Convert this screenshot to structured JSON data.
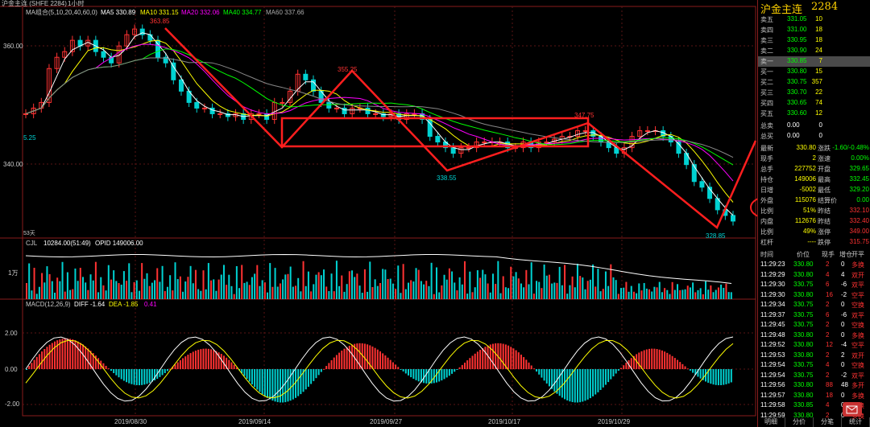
{
  "header": {
    "instrument": "沪金主连 (SHFE 2284)",
    "period": "1小时",
    "ma_title": "MA组合(5,10,20,40,60,0)",
    "ma": [
      {
        "label": "MA5 330.89",
        "color": "#ffffff"
      },
      {
        "label": "MA10 331.15",
        "color": "#ffff00"
      },
      {
        "label": "MA20 332.06",
        "color": "#ff00ff"
      },
      {
        "label": "MA40 334.77",
        "color": "#00ff00"
      },
      {
        "label": "MA60 337.66",
        "color": "#888888"
      }
    ]
  },
  "colors": {
    "up": "#ff3232",
    "down": "#00d2d2",
    "annotation": "#ff1e1e",
    "grid": "#5a1414"
  },
  "price_axis": [
    "360.00",
    "340.00",
    "5.25",
    "53天"
  ],
  "price_labels": {
    "high": "363.85",
    "peak2": "355.25",
    "left": "5.25",
    "low1": "338.55",
    "peak3": "347.75",
    "low2": "328.85",
    "below": "328.8"
  },
  "volume_panel": {
    "title": "CJL",
    "value": "10284.00(51:49)",
    "opid": "OPID 149006.00",
    "axis": "1万"
  },
  "macd_panel": {
    "title": "MACD(12,26,9)",
    "diff": "DIFF -1.64",
    "dea": "DEA -1.85",
    "macd": "0.41",
    "axis": [
      "2.00",
      "0.00",
      "-2.00"
    ]
  },
  "x_axis": [
    "2019/08/30",
    "2019/09/14",
    "2019/09/27",
    "2019/10/17",
    "2019/10/29"
  ],
  "chart_data": {
    "type": "candlestick",
    "title": "沪金主连 (SHFE 2284) 1小时",
    "ylim": [
      326,
      367
    ],
    "annotated_points": [
      {
        "label": "363.85",
        "x": "2019/09/04",
        "y": 363.85
      },
      {
        "label": "355.25",
        "x": "2019/09/24",
        "y": 355.25
      },
      {
        "label": "338.55",
        "x": "2019/10/01",
        "y": 338.55
      },
      {
        "label": "347.75",
        "x": "2019/10/23",
        "y": 347.75
      },
      {
        "label": "328.85",
        "x": "2019/11/08",
        "y": 328.85
      }
    ],
    "close_series": [
      348,
      349,
      350,
      356,
      358,
      359,
      361,
      360,
      361,
      359,
      358,
      357,
      360,
      362,
      363,
      362,
      361,
      358,
      357,
      354,
      352,
      350,
      349,
      349,
      348,
      348,
      347.5,
      348,
      347,
      348,
      348,
      347,
      350,
      350,
      352,
      355,
      354,
      352,
      350,
      349,
      349,
      348,
      349,
      349,
      348,
      348,
      347.5,
      348,
      347,
      348,
      348,
      347,
      344,
      343,
      342,
      341,
      342,
      342,
      343,
      343,
      343,
      343,
      342,
      342,
      343,
      342,
      343,
      343,
      343.5,
      344,
      344,
      345,
      345,
      344,
      343,
      342,
      341,
      342,
      344,
      345,
      345,
      345,
      344,
      343,
      341,
      339,
      336,
      335,
      333,
      331,
      330,
      329
    ]
  },
  "quote": {
    "title": "沪金主连",
    "code": "2284",
    "book": [
      {
        "label": "卖五",
        "price": "331.05",
        "vol": "10"
      },
      {
        "label": "卖四",
        "price": "331.00",
        "vol": "18"
      },
      {
        "label": "卖三",
        "price": "330.95",
        "vol": "18"
      },
      {
        "label": "卖二",
        "price": "330.90",
        "vol": "24"
      },
      {
        "label": "卖一",
        "price": "330.85",
        "vol": "7"
      },
      {
        "label": "买一",
        "price": "330.80",
        "vol": "15"
      },
      {
        "label": "买二",
        "price": "330.75",
        "vol": "357"
      },
      {
        "label": "买三",
        "price": "330.70",
        "vol": "22"
      },
      {
        "label": "买四",
        "price": "330.65",
        "vol": "74"
      },
      {
        "label": "买五",
        "price": "330.60",
        "vol": "12"
      }
    ],
    "totals": [
      {
        "label": "总卖",
        "price": "0.00",
        "vol": "0"
      },
      {
        "label": "总买",
        "price": "0.00",
        "vol": "0"
      }
    ],
    "stats": [
      {
        "l1": "最新",
        "v1": "330.80",
        "l2": "涨跌",
        "v2": "-1.60/-0.48%"
      },
      {
        "l1": "现手",
        "v1": "2",
        "l2": "涨速",
        "v2": "0.00%"
      },
      {
        "l1": "总手",
        "v1": "227752",
        "l2": "开盘",
        "v2": "329.65"
      },
      {
        "l1": "持仓",
        "v1": "149006",
        "l2": "最高",
        "v2": "332.45"
      },
      {
        "l1": "日增",
        "v1": "-5002",
        "l2": "最低",
        "v2": "329.20"
      },
      {
        "l1": "外盘",
        "v1": "115076",
        "l2": "结算价",
        "v2": "0.00"
      },
      {
        "l1": "比例",
        "v1": "51%",
        "l2": "昨结",
        "v2": "332.10"
      },
      {
        "l1": "内盘",
        "v1": "112676",
        "l2": "昨结",
        "v2": "332.40"
      },
      {
        "l1": "比例",
        "v1": "49%",
        "l2": "涨停",
        "v2": "349.00"
      },
      {
        "l1": "杠杆",
        "v1": "----",
        "l2": "跌停",
        "v2": "315.75"
      }
    ],
    "trade_header": [
      "时间",
      "价位",
      "现手",
      "增仓",
      "开平"
    ],
    "trades": [
      [
        "11:29:23",
        "330.80",
        "2",
        "0",
        "多换"
      ],
      [
        "11:29:29",
        "330.80",
        "4",
        "4",
        "双开"
      ],
      [
        "11:29:30",
        "330.75",
        "6",
        "-6",
        "双平"
      ],
      [
        "11:29:30",
        "330.80",
        "16",
        "-2",
        "空平"
      ],
      [
        "11:29:34",
        "330.75",
        "2",
        "0",
        "空换"
      ],
      [
        "11:29:37",
        "330.75",
        "6",
        "-6",
        "双平"
      ],
      [
        "11:29:45",
        "330.75",
        "2",
        "0",
        "空换"
      ],
      [
        "11:29:48",
        "330.80",
        "2",
        "0",
        "多换"
      ],
      [
        "11:29:52",
        "330.80",
        "12",
        "-4",
        "空平"
      ],
      [
        "11:29:53",
        "330.80",
        "2",
        "2",
        "双开"
      ],
      [
        "11:29:54",
        "330.75",
        "4",
        "0",
        "空换"
      ],
      [
        "11:29:54",
        "330.75",
        "2",
        "-2",
        "双平"
      ],
      [
        "11:29:56",
        "330.80",
        "88",
        "48",
        "多开"
      ],
      [
        "11:29:57",
        "330.80",
        "18",
        "0",
        "多换"
      ],
      [
        "11:29:58",
        "330.85",
        "4",
        "0",
        "多换"
      ],
      [
        "11:29:59",
        "330.80",
        "2",
        "0",
        "多换"
      ]
    ],
    "tabs": [
      "明细",
      "分价",
      "分笔",
      "统计"
    ]
  }
}
